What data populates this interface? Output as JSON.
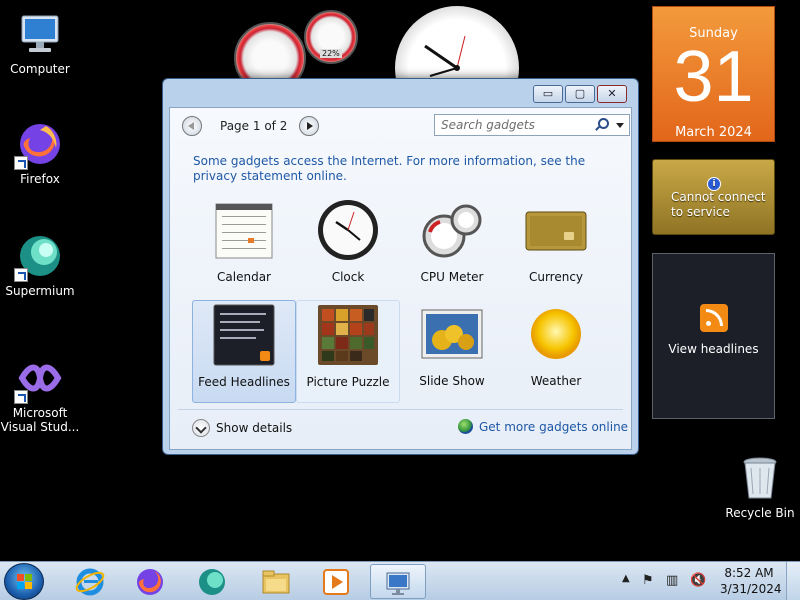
{
  "desktop": {
    "icons": [
      {
        "label": "Computer"
      },
      {
        "label": "Firefox"
      },
      {
        "label": "Supermium"
      },
      {
        "label": "Microsoft Visual Stud..."
      },
      {
        "label": "Recycle Bin"
      }
    ]
  },
  "gadgets": {
    "calendar": {
      "weekday": "Sunday",
      "date": "31",
      "month_year": "March 2024"
    },
    "currency": {
      "message": "Cannot connect to service"
    },
    "feed": {
      "link": "View headlines"
    },
    "cpu": {
      "percent": "22%"
    }
  },
  "window": {
    "pager": {
      "text": "Page 1 of 2"
    },
    "search": {
      "placeholder": "Search gadgets"
    },
    "notice": "Some gadgets access the Internet.  For more information, see the privacy statement online.",
    "gadgets": [
      {
        "label": "Calendar"
      },
      {
        "label": "Clock"
      },
      {
        "label": "CPU Meter"
      },
      {
        "label": "Currency"
      },
      {
        "label": "Feed Headlines"
      },
      {
        "label": "Picture Puzzle"
      },
      {
        "label": "Slide Show"
      },
      {
        "label": "Weather"
      }
    ],
    "show_details": "Show details",
    "get_more": "Get more gadgets online",
    "buttons": {
      "min": "▭",
      "max": "▢",
      "close": "✕"
    }
  },
  "taskbar": {
    "time": "8:52 AM",
    "date": "3/31/2024",
    "tray_icons": [
      "show-hidden-icon",
      "action-center-flag-icon",
      "network-icon",
      "volume-muted-icon"
    ]
  }
}
